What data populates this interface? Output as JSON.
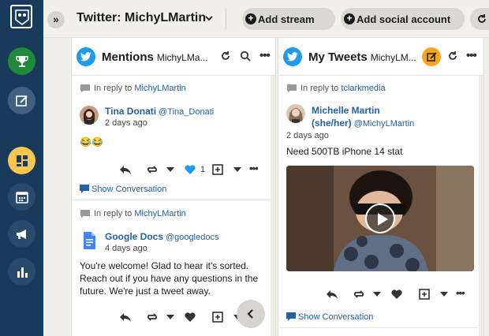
{
  "header": {
    "tab_title": "Twitter: MichyLMartin",
    "add_stream": "Add stream",
    "add_social_account": "Add social account"
  },
  "streams": [
    {
      "name": "Mentions",
      "account": "MichyLMa...",
      "tweets": [
        {
          "reply_prefix": "In reply to",
          "reply_to": "MichyLMartin",
          "author": "Tina Donati",
          "handle": "@Tina_Donati",
          "time": "2 days ago",
          "text": "😂😂",
          "like_count": "1",
          "show_conversation": "Show Conversation"
        },
        {
          "reply_prefix": "In reply to",
          "reply_to": "MichyLMartin",
          "author": "Google Docs",
          "handle": "@googledocs",
          "time": "4 days ago",
          "text": "You're welcome! Glad to hear it's sorted. Reach out if you have any questions in the future. We're just a tweet away."
        }
      ]
    },
    {
      "name": "My Tweets",
      "account": "MichyLM...",
      "tweets": [
        {
          "reply_prefix": "In reply to",
          "reply_to": "tclarkmedia",
          "author": "Michelle Martin",
          "author_line2": "(she/her)",
          "handle": "@MichyLMartin",
          "time": "2 days ago",
          "text": "Need 500TB iPhone 14 stat",
          "show_conversation": "Show Conversation"
        }
      ]
    }
  ],
  "icons": {
    "rail": [
      "owl-logo-icon",
      "trophy-icon",
      "compose-icon",
      "dashboard-icon",
      "calendar-icon",
      "megaphone-icon",
      "analytics-icon"
    ]
  },
  "colors": {
    "rail_bg": "#1a3a5c",
    "twitter_blue": "#1d9bf0",
    "link": "#2461a8",
    "active_yellow": "#f9c74f",
    "trophy_green": "#1f8a3c"
  }
}
